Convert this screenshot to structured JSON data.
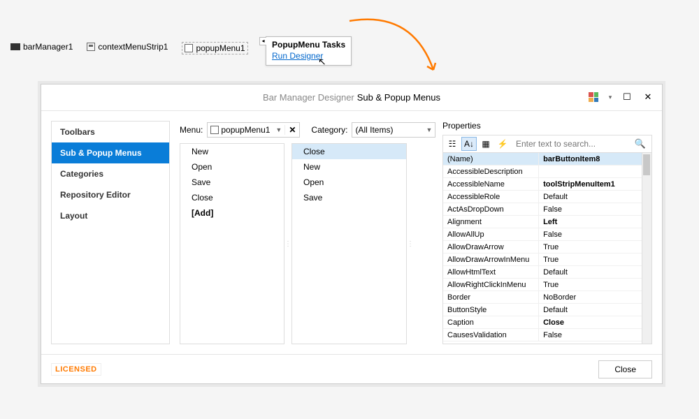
{
  "tray": {
    "bar_manager": "barManager1",
    "context_menu": "contextMenuStrip1",
    "popup_menu": "popupMenu1"
  },
  "smarttag": {
    "title": "PopupMenu Tasks",
    "link": "Run Designer"
  },
  "dialog": {
    "title_prefix": "Bar Manager Designer",
    "title_suffix": "Sub & Popup Menus",
    "sidebar": [
      "Toolbars",
      "Sub & Popup Menus",
      "Categories",
      "Repository Editor",
      "Layout"
    ],
    "sidebar_active": 1,
    "toolbar": {
      "menu_label": "Menu:",
      "menu_value": "popupMenu1",
      "category_label": "Category:",
      "category_value": "(All Items)"
    },
    "list_left": [
      "New",
      "Open",
      "Save",
      "Close",
      "[Add]"
    ],
    "list_right": [
      "Close",
      "New",
      "Open",
      "Save"
    ],
    "list_right_selected": 0,
    "properties_label": "Properties",
    "search_placeholder": "Enter text to search...",
    "props": [
      {
        "k": "(Name)",
        "v": "barButtonItem8",
        "bold": true,
        "sel": true
      },
      {
        "k": "AccessibleDescription",
        "v": ""
      },
      {
        "k": "AccessibleName",
        "v": "toolStripMenuItem1",
        "bold": true
      },
      {
        "k": "AccessibleRole",
        "v": "Default"
      },
      {
        "k": "ActAsDropDown",
        "v": "False"
      },
      {
        "k": "Alignment",
        "v": "Left",
        "bold": true
      },
      {
        "k": "AllowAllUp",
        "v": "False"
      },
      {
        "k": "AllowDrawArrow",
        "v": "True"
      },
      {
        "k": "AllowDrawArrowInMenu",
        "v": "True"
      },
      {
        "k": "AllowHtmlText",
        "v": "Default"
      },
      {
        "k": "AllowRightClickInMenu",
        "v": "True"
      },
      {
        "k": "Border",
        "v": "NoBorder"
      },
      {
        "k": "ButtonStyle",
        "v": "Default"
      },
      {
        "k": "Caption",
        "v": "Close",
        "bold": true
      },
      {
        "k": "CausesValidation",
        "v": "False"
      }
    ],
    "licensed": "LICENSED",
    "close_label": "Close"
  }
}
